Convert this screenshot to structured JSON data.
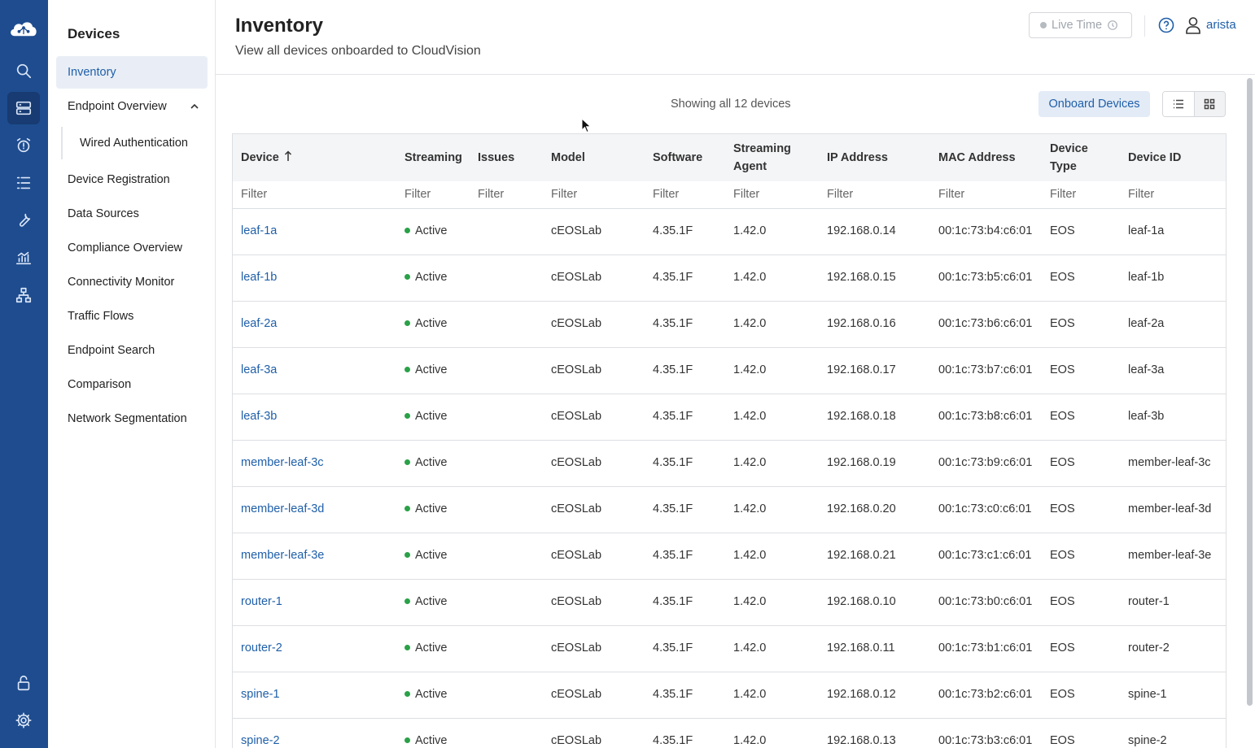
{
  "app": {
    "brand": "CloudVision"
  },
  "rail": {
    "items": [
      "cloud-logo-icon",
      "search-icon",
      "devices-icon",
      "alarm-clock-icon",
      "tasks-list-icon",
      "wrench-icon",
      "dashboard-chart-icon",
      "topology-icon"
    ],
    "bottom": [
      "unlock-icon",
      "gear-icon"
    ]
  },
  "subnav": {
    "title": "Devices",
    "items": [
      {
        "label": "Inventory"
      },
      {
        "label": "Endpoint Overview"
      },
      {
        "label": "Wired Authentication"
      },
      {
        "label": "Device Registration"
      },
      {
        "label": "Data Sources"
      },
      {
        "label": "Compliance Overview"
      },
      {
        "label": "Connectivity Monitor"
      },
      {
        "label": "Traffic Flows"
      },
      {
        "label": "Endpoint Search"
      },
      {
        "label": "Comparison"
      },
      {
        "label": "Network Segmentation"
      }
    ]
  },
  "header": {
    "title": "Inventory",
    "subtitle": "View all devices onboarded to CloudVision",
    "live_time": "Live Time",
    "user": "arista"
  },
  "toolbar": {
    "count_text": "Showing all 12 devices",
    "onboard_label": "Onboard Devices"
  },
  "table": {
    "columns": [
      "Device",
      "Streaming",
      "Issues",
      "Model",
      "Software",
      "Streaming Agent",
      "IP Address",
      "MAC Address",
      "Device Type",
      "Device ID"
    ],
    "filter_placeholder": "Filter",
    "rows": [
      {
        "device": "leaf-1a",
        "streaming": "Active",
        "issues": "",
        "model": "cEOSLab",
        "software": "4.35.1F",
        "agent": "1.42.0",
        "ip": "192.168.0.14",
        "mac": "00:1c:73:b4:c6:01",
        "type": "EOS",
        "id": "leaf-1a"
      },
      {
        "device": "leaf-1b",
        "streaming": "Active",
        "issues": "",
        "model": "cEOSLab",
        "software": "4.35.1F",
        "agent": "1.42.0",
        "ip": "192.168.0.15",
        "mac": "00:1c:73:b5:c6:01",
        "type": "EOS",
        "id": "leaf-1b"
      },
      {
        "device": "leaf-2a",
        "streaming": "Active",
        "issues": "",
        "model": "cEOSLab",
        "software": "4.35.1F",
        "agent": "1.42.0",
        "ip": "192.168.0.16",
        "mac": "00:1c:73:b6:c6:01",
        "type": "EOS",
        "id": "leaf-2a"
      },
      {
        "device": "leaf-3a",
        "streaming": "Active",
        "issues": "",
        "model": "cEOSLab",
        "software": "4.35.1F",
        "agent": "1.42.0",
        "ip": "192.168.0.17",
        "mac": "00:1c:73:b7:c6:01",
        "type": "EOS",
        "id": "leaf-3a"
      },
      {
        "device": "leaf-3b",
        "streaming": "Active",
        "issues": "",
        "model": "cEOSLab",
        "software": "4.35.1F",
        "agent": "1.42.0",
        "ip": "192.168.0.18",
        "mac": "00:1c:73:b8:c6:01",
        "type": "EOS",
        "id": "leaf-3b"
      },
      {
        "device": "member-leaf-3c",
        "streaming": "Active",
        "issues": "",
        "model": "cEOSLab",
        "software": "4.35.1F",
        "agent": "1.42.0",
        "ip": "192.168.0.19",
        "mac": "00:1c:73:b9:c6:01",
        "type": "EOS",
        "id": "member-leaf-3c"
      },
      {
        "device": "member-leaf-3d",
        "streaming": "Active",
        "issues": "",
        "model": "cEOSLab",
        "software": "4.35.1F",
        "agent": "1.42.0",
        "ip": "192.168.0.20",
        "mac": "00:1c:73:c0:c6:01",
        "type": "EOS",
        "id": "member-leaf-3d"
      },
      {
        "device": "member-leaf-3e",
        "streaming": "Active",
        "issues": "",
        "model": "cEOSLab",
        "software": "4.35.1F",
        "agent": "1.42.0",
        "ip": "192.168.0.21",
        "mac": "00:1c:73:c1:c6:01",
        "type": "EOS",
        "id": "member-leaf-3e"
      },
      {
        "device": "router-1",
        "streaming": "Active",
        "issues": "",
        "model": "cEOSLab",
        "software": "4.35.1F",
        "agent": "1.42.0",
        "ip": "192.168.0.10",
        "mac": "00:1c:73:b0:c6:01",
        "type": "EOS",
        "id": "router-1"
      },
      {
        "device": "router-2",
        "streaming": "Active",
        "issues": "",
        "model": "cEOSLab",
        "software": "4.35.1F",
        "agent": "1.42.0",
        "ip": "192.168.0.11",
        "mac": "00:1c:73:b1:c6:01",
        "type": "EOS",
        "id": "router-2"
      },
      {
        "device": "spine-1",
        "streaming": "Active",
        "issues": "",
        "model": "cEOSLab",
        "software": "4.35.1F",
        "agent": "1.42.0",
        "ip": "192.168.0.12",
        "mac": "00:1c:73:b2:c6:01",
        "type": "EOS",
        "id": "spine-1"
      },
      {
        "device": "spine-2",
        "streaming": "Active",
        "issues": "",
        "model": "cEOSLab",
        "software": "4.35.1F",
        "agent": "1.42.0",
        "ip": "192.168.0.13",
        "mac": "00:1c:73:b3:c6:01",
        "type": "EOS",
        "id": "spine-2"
      }
    ]
  },
  "colors": {
    "rail_bg": "#1e4c8f",
    "accent": "#1f5fa9",
    "status_active": "#2aa148"
  }
}
